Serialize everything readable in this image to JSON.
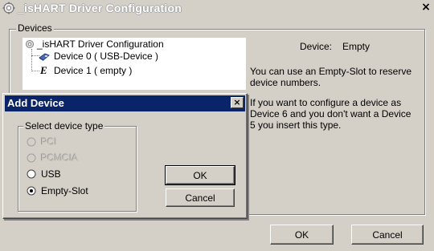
{
  "window": {
    "title": "_isHART Driver Configuration",
    "close_glyph": "×",
    "app_icon": "gear-icon"
  },
  "devices_group": {
    "label": "Devices",
    "tree": [
      {
        "label": "_isHART Driver Configuration",
        "icon": "gear-icon"
      },
      {
        "label": "Device 0  ( USB-Device )",
        "icon": "usb-device-icon"
      },
      {
        "label": "Device 1  ( empty )",
        "icon": "empty-slot-icon"
      }
    ]
  },
  "info": {
    "device_label": "Device:",
    "device_value": "Empty",
    "paragraph1": "You can use an Empty-Slot to reserve device numbers.",
    "paragraph2": "If you want to configure a device as Device 6 and you don't want a Device 5 you insert this type."
  },
  "main_buttons": {
    "ok": "OK",
    "cancel": "Cancel"
  },
  "dialog": {
    "title": "Add Device",
    "close_glyph": "×",
    "group_label": "Select device type",
    "options": [
      {
        "label": "PCI",
        "enabled": false,
        "selected": false
      },
      {
        "label": "PCMCIA",
        "enabled": false,
        "selected": false
      },
      {
        "label": "USB",
        "enabled": true,
        "selected": false
      },
      {
        "label": "Empty-Slot",
        "enabled": true,
        "selected": true
      }
    ],
    "ok": "OK",
    "cancel": "Cancel"
  }
}
